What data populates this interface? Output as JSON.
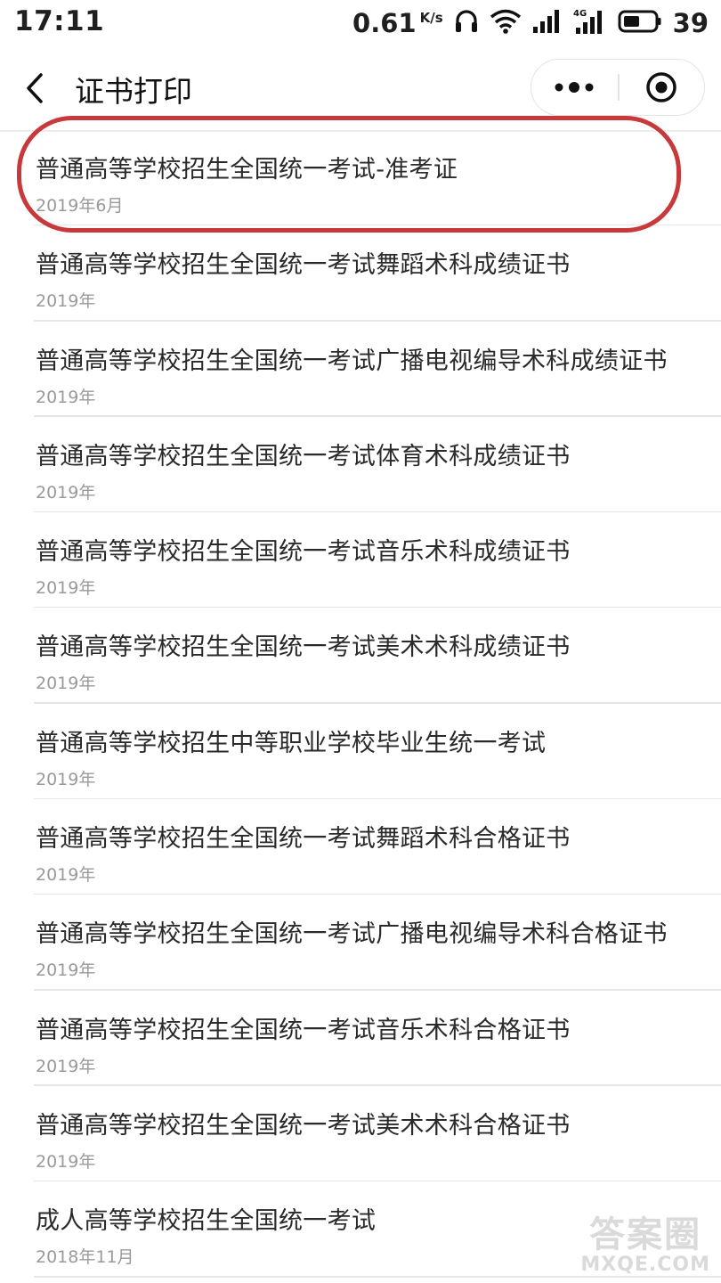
{
  "status_bar": {
    "time": "17:11",
    "speed": "0.61",
    "speed_unit": "K/s",
    "battery": "39",
    "icons": [
      "headphones-icon",
      "wifi-icon",
      "signal-icon",
      "signal-4g-icon",
      "battery-icon"
    ]
  },
  "nav": {
    "title": "证书打印",
    "back_icon": "chevron-left-icon",
    "more_icon": "more-dots-icon",
    "close_icon": "target-circle-icon"
  },
  "items": [
    {
      "title": "普通高等学校招生全国统一考试-准考证",
      "date": "2019年6月"
    },
    {
      "title": "普通高等学校招生全国统一考试舞蹈术科成绩证书",
      "date": "2019年"
    },
    {
      "title": "普通高等学校招生全国统一考试广播电视编导术科成绩证书",
      "date": "2019年"
    },
    {
      "title": "普通高等学校招生全国统一考试体育术科成绩证书",
      "date": "2019年"
    },
    {
      "title": "普通高等学校招生全国统一考试音乐术科成绩证书",
      "date": "2019年"
    },
    {
      "title": "普通高等学校招生全国统一考试美术术科成绩证书",
      "date": "2019年"
    },
    {
      "title": "普通高等学校招生中等职业学校毕业生统一考试",
      "date": "2019年"
    },
    {
      "title": "普通高等学校招生全国统一考试舞蹈术科合格证书",
      "date": "2019年"
    },
    {
      "title": "普通高等学校招生全国统一考试广播电视编导术科合格证书",
      "date": "2019年"
    },
    {
      "title": "普通高等学校招生全国统一考试音乐术科合格证书",
      "date": "2019年"
    },
    {
      "title": "普通高等学校招生全国统一考试美术术科合格证书",
      "date": "2019年"
    },
    {
      "title": "成人高等学校招生全国统一考试",
      "date": "2018年11月"
    }
  ],
  "highlight_color": "#c8393b",
  "watermark": {
    "top": "答案圈",
    "bottom": "MXQE.COM"
  }
}
